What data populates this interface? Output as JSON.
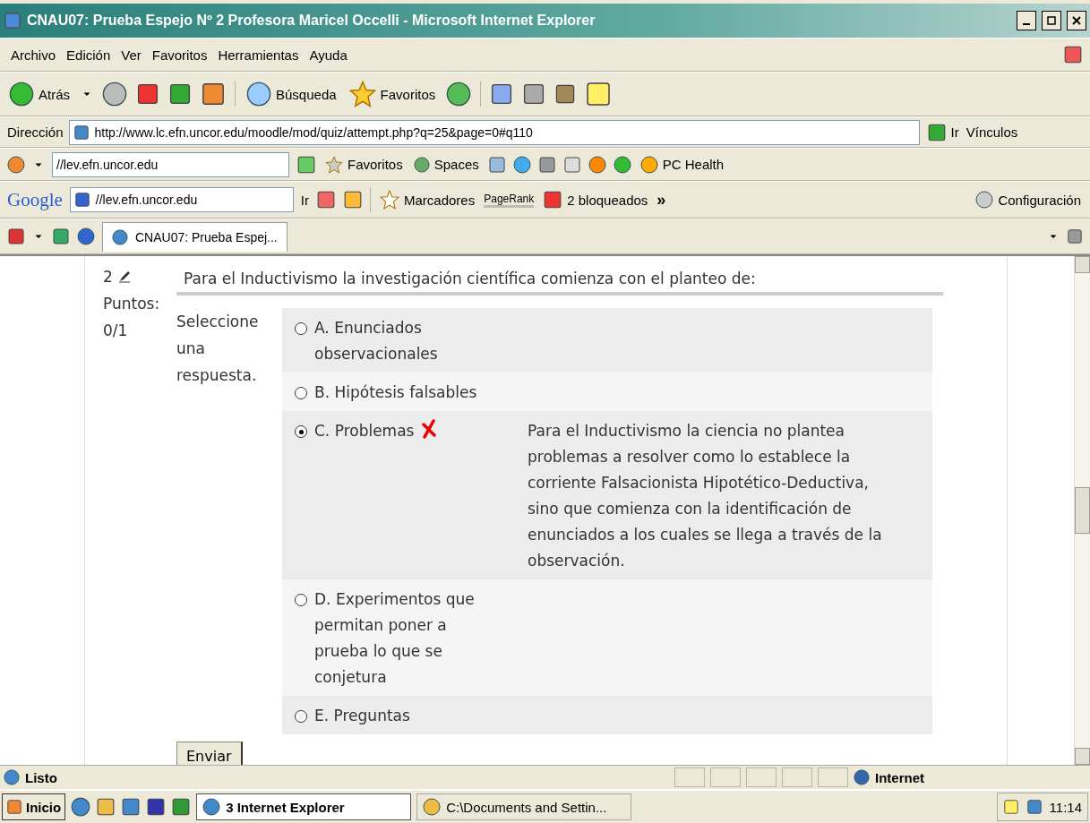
{
  "window": {
    "title": "CNAU07: Prueba Espejo Nº 2 Profesora Maricel Occelli - Microsoft Internet Explorer"
  },
  "menu": [
    "Archivo",
    "Edición",
    "Ver",
    "Favoritos",
    "Herramientas",
    "Ayuda"
  ],
  "toolbar": {
    "back": "Atrás",
    "search": "Búsqueda",
    "favorites": "Favoritos"
  },
  "address": {
    "label": "Dirección",
    "value": "http://www.lc.efn.uncor.edu/moodle/mod/quiz/attempt.php?q=25&page=0#q110",
    "go": "Ir",
    "links": "Vínculos"
  },
  "live_bar": {
    "search_value": "//lev.efn.uncor.edu",
    "favorites": "Favoritos",
    "spaces": "Spaces",
    "health": "PC Health"
  },
  "google_bar": {
    "logo": "Google",
    "search_value": "//lev.efn.uncor.edu",
    "go": "Ir",
    "bookmarks": "Marcadores",
    "pagerank": "PageRank",
    "blocked": "2 bloqueados",
    "more": "»",
    "settings": "Configuración"
  },
  "tabs": [
    {
      "label": "CNAU07: Prueba Espej...",
      "selected": true
    }
  ],
  "question": {
    "number": "2",
    "points_label": "Puntos:",
    "points": "0/1",
    "prompt": "Para el Inductivismo la investigación científica comienza con el planteo de:",
    "instruction": "Seleccione una respuesta.",
    "options": [
      {
        "label": "A. Enunciados observacionales",
        "selected": false,
        "wrong": false
      },
      {
        "label": "B. Hipótesis falsables",
        "selected": false,
        "wrong": false
      },
      {
        "label": "C. Problemas",
        "selected": true,
        "wrong": true,
        "feedback": "Para el Inductivismo la ciencia no plantea problemas a resolver como lo establece la corriente Falsacionista Hipotético-Deductiva, sino que comienza con la identificación de enunciados a los cuales se llega a través de la observación."
      },
      {
        "label": "D. Experimentos que permitan poner a prueba lo que se conjetura",
        "selected": false,
        "wrong": false
      },
      {
        "label": "E. Preguntas",
        "selected": false,
        "wrong": false
      }
    ],
    "submit": "Enviar"
  },
  "status_bar": {
    "text": "Listo",
    "zone": "Internet"
  },
  "taskbar": {
    "start": "Inicio",
    "tasks": [
      {
        "label": "3 Internet Explorer",
        "selected": true
      },
      {
        "label": "C:\\Documents and Settin...",
        "selected": false
      }
    ],
    "clock": "11:14"
  }
}
